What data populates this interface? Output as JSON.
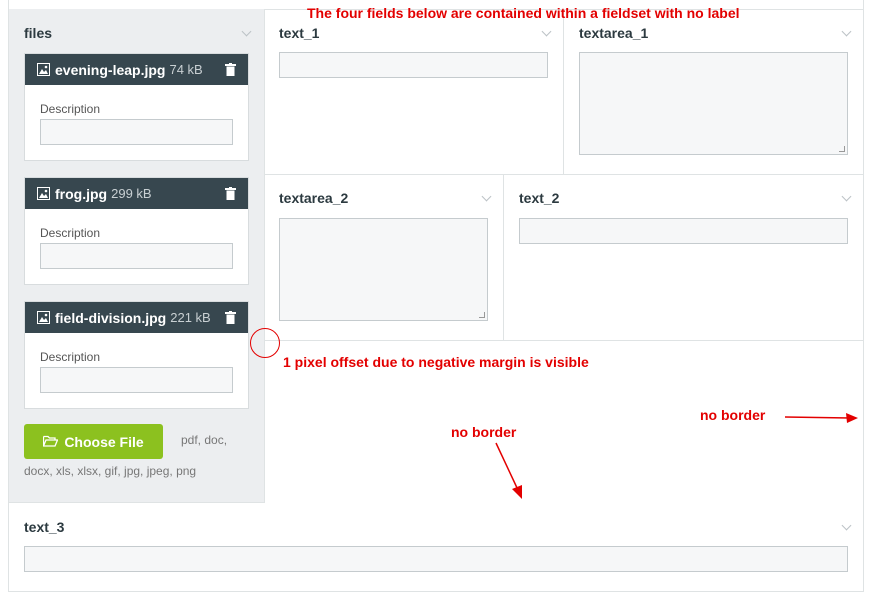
{
  "annotations": {
    "top_note": "The four fields below are contained within a fieldset with no label",
    "offset_note": "1 pixel offset due to negative margin is visible",
    "no_border_right": "no border",
    "no_border_center": "no border"
  },
  "files_panel": {
    "title": "files",
    "files": [
      {
        "name": "evening-leap.jpg",
        "size": "74 kB",
        "description_label": "Description",
        "description_value": ""
      },
      {
        "name": "frog.jpg",
        "size": "299 kB",
        "description_label": "Description",
        "description_value": ""
      },
      {
        "name": "field-division.jpg",
        "size": "221 kB",
        "description_label": "Description",
        "description_value": ""
      }
    ],
    "choose_button": "Choose File",
    "allowed_types_line1": "pdf, doc,",
    "allowed_types_line2": "docx, xls, xlsx, gif, jpg, jpeg, png"
  },
  "fieldset": {
    "text_1": {
      "label": "text_1",
      "value": ""
    },
    "textarea_1": {
      "label": "textarea_1",
      "value": ""
    },
    "textarea_2": {
      "label": "textarea_2",
      "value": ""
    },
    "text_2": {
      "label": "text_2",
      "value": ""
    }
  },
  "text_3": {
    "label": "text_3",
    "value": ""
  },
  "colors": {
    "file_header": "#37474f",
    "choose_button": "#8cc11f",
    "annotation": "#e30000",
    "sidebar_bg": "#eceef0"
  },
  "icons": {
    "file": "image-file-icon",
    "trash": "trash-icon",
    "folder": "folder-open-icon",
    "collapse": "chevron-down-icon"
  }
}
